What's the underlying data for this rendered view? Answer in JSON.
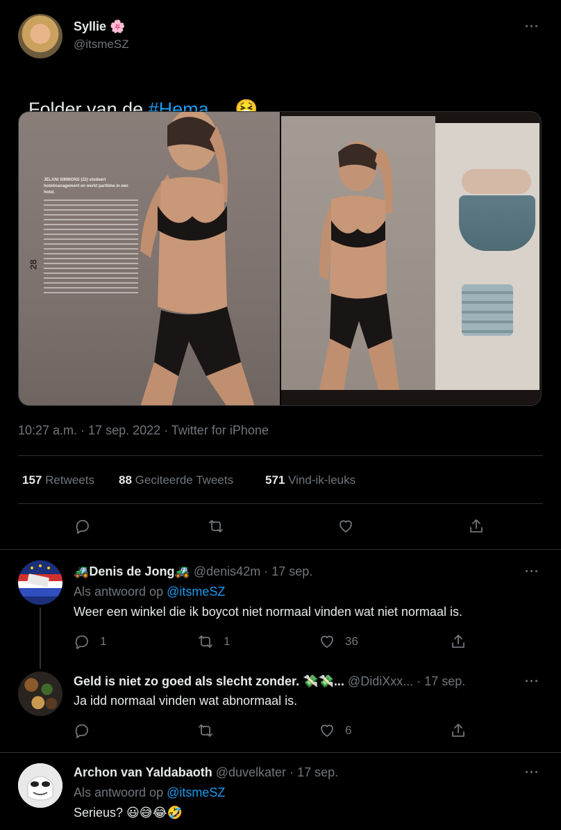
{
  "tweet": {
    "author_name": "Syllie",
    "author_emoji": "🌸",
    "handle": "@itsmeSZ",
    "text_before": "Folder van de ",
    "hashtag": "#Hema",
    "text_after": " ... ",
    "text_emoji": "🤮",
    "timestamp": "10:27 a.m. · 17 sep. 2022 · Twitter for iPhone",
    "stats": {
      "retweets_count": "157",
      "retweets_label": "Retweets",
      "quotes_count": "88",
      "quotes_label": "Geciteerde Tweets",
      "likes_count": "571",
      "likes_label": "Vind-ik-leuks"
    },
    "more": "···"
  },
  "replies": [
    {
      "name": "🚜Denis de Jong🚜",
      "handle": "@denis42m",
      "time": "· 17 sep.",
      "reply_to_label": "Als antwoord op",
      "reply_to_handle": "@itsmeSZ",
      "text": "Weer een winkel die ik boycot niet normaal vinden wat niet normaal is.",
      "reply_count": "1",
      "retweet_count": "1",
      "like_count": "36"
    },
    {
      "name": "Geld is niet zo goed als slecht zonder. 💸💸...",
      "handle": "@DidiXxx...",
      "time": "· 17 sep.",
      "text": "Ja idd normaal vinden wat abnormaal is.",
      "like_count": "6"
    },
    {
      "name": "Archon van Yaldabaoth",
      "handle": "@duvelkater",
      "time": "· 17 sep.",
      "reply_to_label": "Als antwoord op",
      "reply_to_handle": "@itsmeSZ",
      "text": "Serieus? 😃😅😂🤣"
    }
  ],
  "photo_left": {
    "page_number": "28",
    "caption_title": "JELANI SIMMONS (22) studeert hotelmanagement en werkt parttime in een hotel."
  },
  "colors": {
    "accent": "#1d9bf0",
    "muted": "#71767b",
    "divider": "#2f3336"
  }
}
